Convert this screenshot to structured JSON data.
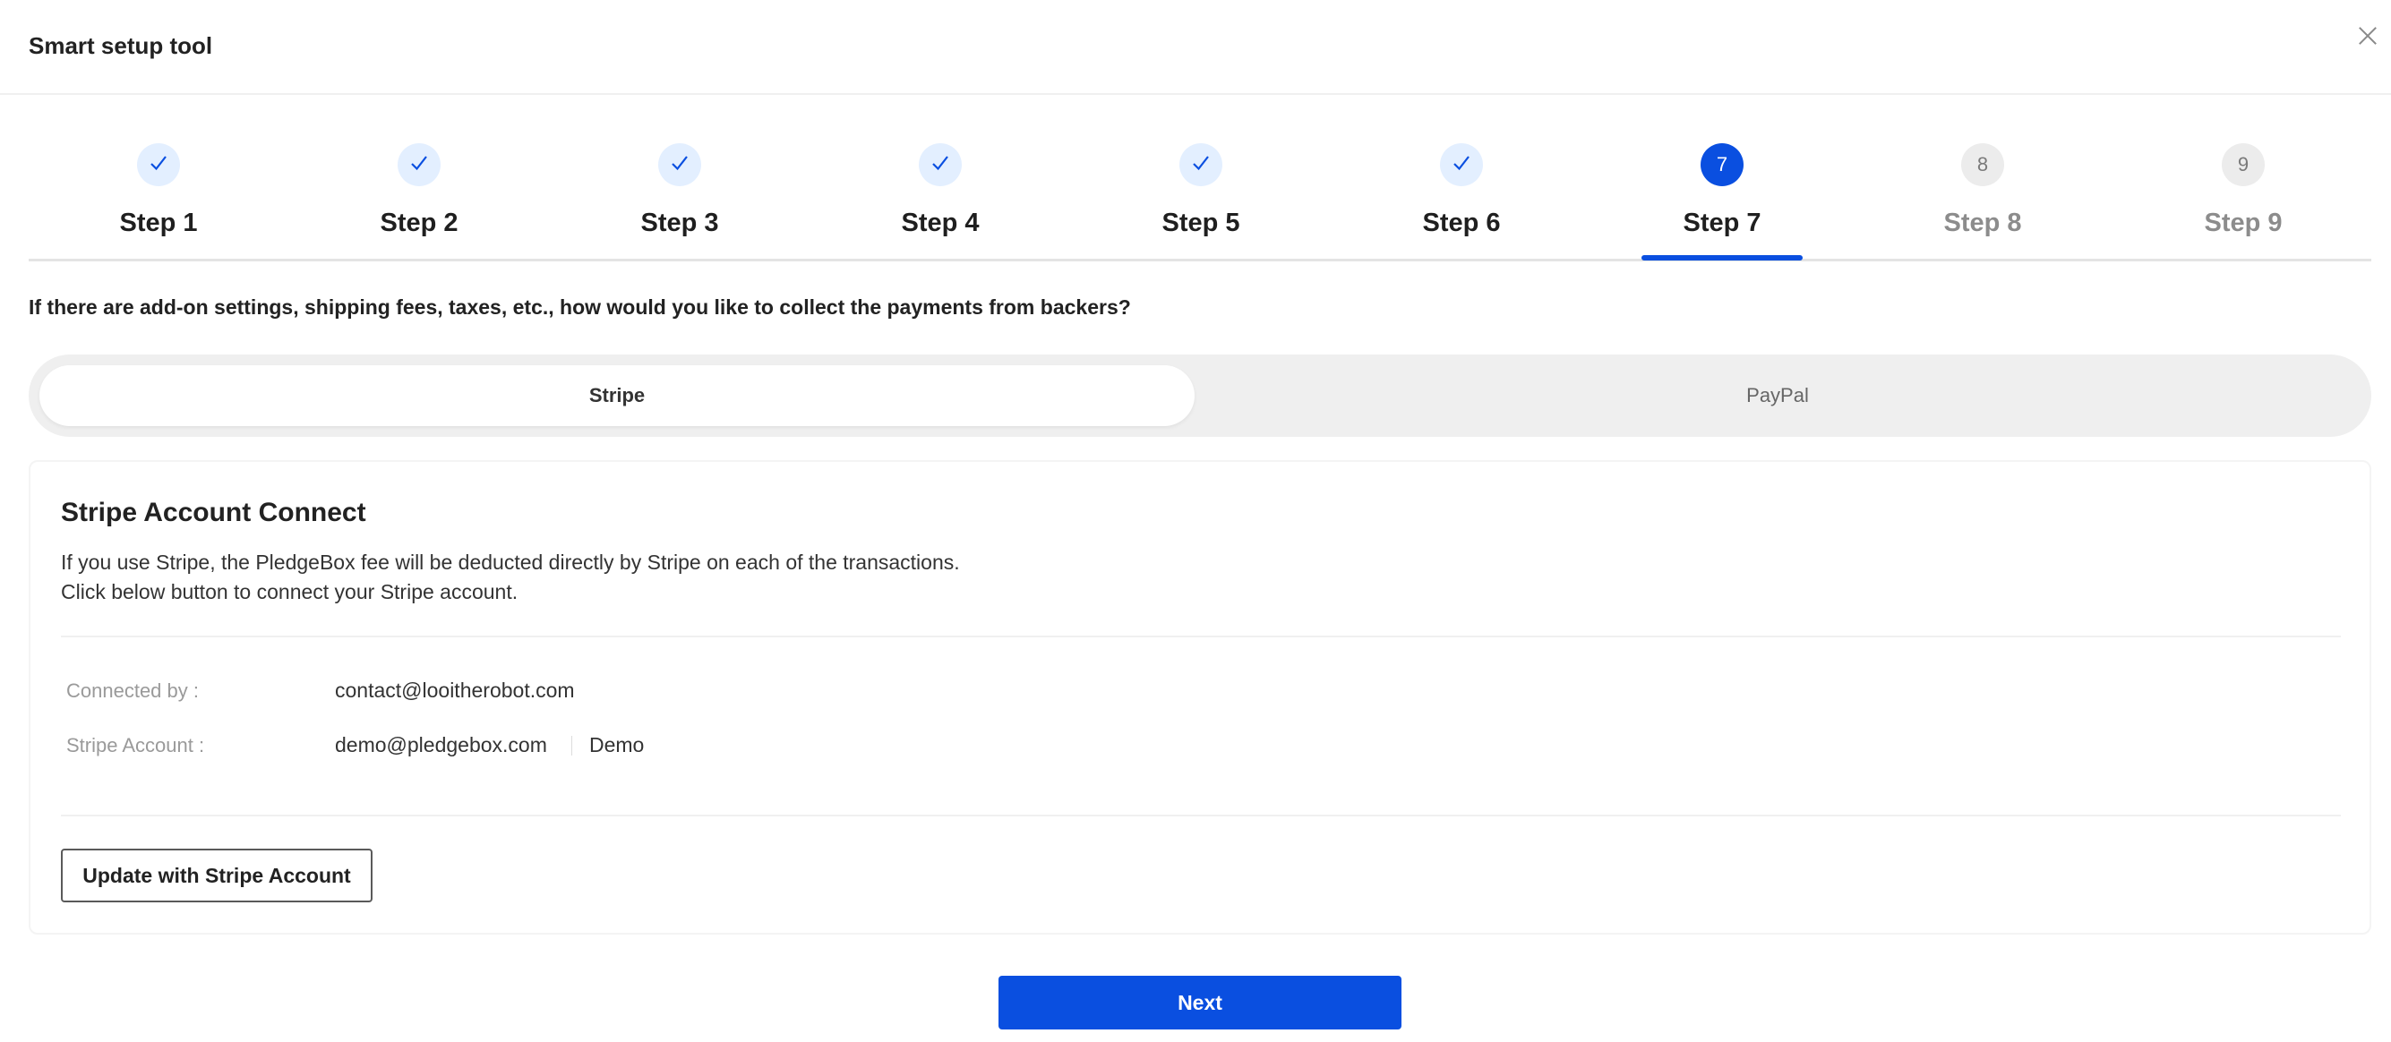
{
  "header": {
    "title": "Smart setup tool",
    "close_icon": "close-icon"
  },
  "steps": [
    {
      "label": "Step 1",
      "number": "1",
      "status": "done"
    },
    {
      "label": "Step 2",
      "number": "2",
      "status": "done"
    },
    {
      "label": "Step 3",
      "number": "3",
      "status": "done"
    },
    {
      "label": "Step 4",
      "number": "4",
      "status": "done"
    },
    {
      "label": "Step 5",
      "number": "5",
      "status": "done"
    },
    {
      "label": "Step 6",
      "number": "6",
      "status": "done"
    },
    {
      "label": "Step 7",
      "number": "7",
      "status": "active"
    },
    {
      "label": "Step 8",
      "number": "8",
      "status": "todo"
    },
    {
      "label": "Step 9",
      "number": "9",
      "status": "todo"
    }
  ],
  "question": "If there are add-on settings, shipping fees, taxes, etc., how would you like to collect the payments from backers?",
  "payment_toggle": {
    "options": [
      "Stripe",
      "PayPal"
    ],
    "selected": "Stripe"
  },
  "stripe_card": {
    "title": "Stripe Account Connect",
    "description_line1": "If you use Stripe, the PledgeBox fee will be deducted directly by Stripe on each of the transactions.",
    "description_line2": "Click below button to connect your Stripe account.",
    "connected_by_label": "Connected by :",
    "connected_by_value": "contact@looitherobot.com",
    "stripe_account_label": "Stripe Account :",
    "stripe_account_email": "demo@pledgebox.com",
    "stripe_account_name": "Demo",
    "update_button": "Update with Stripe Account"
  },
  "footer": {
    "next_label": "Next"
  },
  "colors": {
    "accent": "#0a4fe0",
    "done_bg": "#e3efff",
    "todo_bg": "#ececec"
  }
}
